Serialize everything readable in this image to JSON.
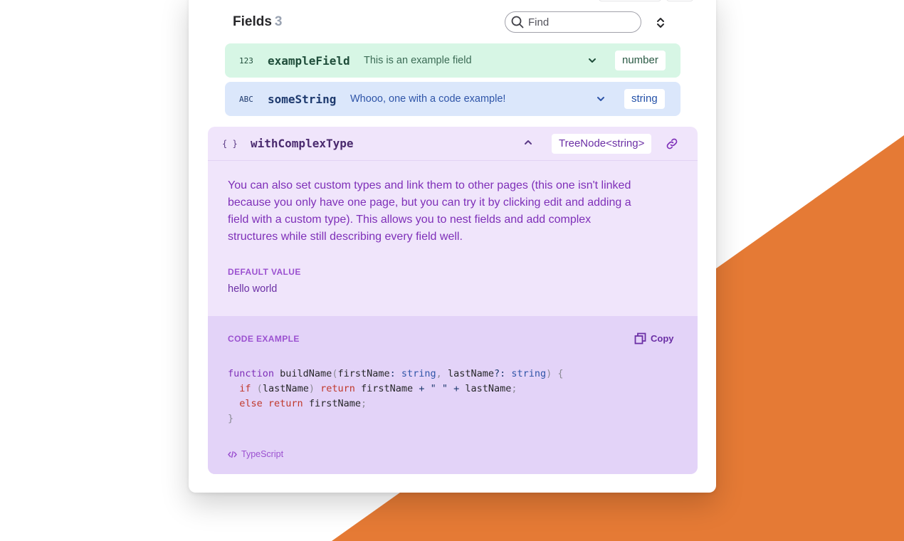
{
  "colors": {
    "accent_orange": "#e57a35",
    "green_row_bg": "#d7f6e5",
    "blue_row_bg": "#dbe7fb",
    "purple_panel_bg": "#f0e5fb",
    "purple_code_bg": "#e3d3f8"
  },
  "fields": {
    "title": "Fields",
    "count": "3"
  },
  "search": {
    "placeholder": "Find",
    "icon": "search-icon"
  },
  "sort": {
    "icon": "sort-updown-icon"
  },
  "rows": [
    {
      "type_icon": "123",
      "name": "exampleField",
      "description": "This is an example field",
      "type": "number",
      "expand_icon": "chevron-down-icon"
    },
    {
      "type_icon": "ABC",
      "name": "someString",
      "description": "Whooo, one with a code example!",
      "type": "string",
      "expand_icon": "chevron-down-icon"
    }
  ],
  "complex": {
    "type_icon": "{ }",
    "name": "withComplexType",
    "type": "TreeNode<string>",
    "collapse_icon": "chevron-up-icon",
    "link_icon": "link-icon",
    "description": "You can also set custom types and link them to other pages (this one isn't linked because you only have one page, but you can try it by clicking edit and adding a field with a custom type). This allows you to nest fields and add complex structures while still describing every field well.",
    "default_label": "DEFAULT VALUE",
    "default_value": "hello world",
    "code_label": "CODE EXAMPLE",
    "copy_label": "Copy",
    "language": "TypeScript"
  }
}
